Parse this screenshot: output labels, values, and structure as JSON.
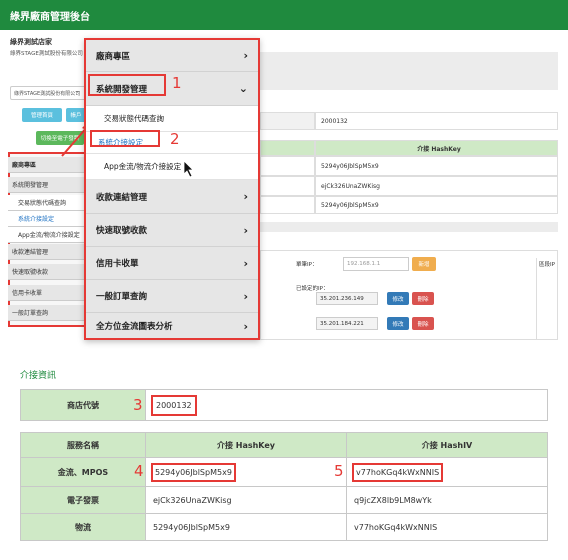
{
  "app": {
    "title": "綠界廠商管理後台"
  },
  "store": {
    "name": "綠界測試店家",
    "company": "綠界STAGE測試股份有限公司"
  },
  "store_dropdown": {
    "value": "綠界STAGE測試股份有限公司"
  },
  "buttons": {
    "btn1": "管理首頁",
    "btn2": "帳戶",
    "btn3": "切換至電子發票"
  },
  "sidebar_small": [
    "廠商專區",
    "系統開發管理",
    "交易狀態代碼查詢",
    "系統介接設定",
    "App金流/物流介接設定",
    "收款連結管理",
    "快速取號收款",
    "信用卡收單",
    "一般訂單查詢"
  ],
  "bg_table": {
    "store_id": "2000132",
    "hashkey_header": "介接 HashKey",
    "keys": [
      "5294y06JblSpM5x9",
      "ejCk326UnaZWKisg",
      "5294y06JblSpM5x9"
    ]
  },
  "ip": {
    "label": "單筆IP：",
    "placeholder": "192.168.1.1",
    "add": "新增",
    "set_label": "已設定的IP：",
    "ips": [
      "35.201.236.149",
      "35.201.184.221"
    ],
    "edit": "修改",
    "delete": "刪除",
    "range_label": "區段IP"
  },
  "menu": {
    "items": [
      "廠商專區",
      "系統開發管理",
      "收款連結管理",
      "快速取號收款",
      "信用卡收單",
      "一般訂單查詢",
      "全方位金流圖表分析"
    ],
    "subitems": [
      "交易狀態代碼查詢",
      "系統介接設定",
      "App金流/物流介接設定"
    ]
  },
  "annotations": [
    "1",
    "2",
    "3",
    "4",
    "5"
  ],
  "section": {
    "title": "介接資訊"
  },
  "store_table": {
    "label": "商店代號",
    "value": "2000132"
  },
  "hash_table": {
    "headers": [
      "服務名稱",
      "介接 HashKey",
      "介接 HashIV"
    ],
    "rows": [
      {
        "name": "金流、MPOS",
        "key": "5294y06JblSpM5x9",
        "iv": "v77hoKGq4kWxNNIS"
      },
      {
        "name": "電子發票",
        "key": "ejCk326UnaZWKisg",
        "iv": "q9jcZX8lb9LM8wYk"
      },
      {
        "name": "物流",
        "key": "5294y06JblSpM5x9",
        "iv": "v77hoKGq4kWxNNIS"
      }
    ]
  },
  "colors": {
    "brand": "#1f8a3e",
    "annotation": "#e53935",
    "header_green": "#cfe9c6"
  }
}
